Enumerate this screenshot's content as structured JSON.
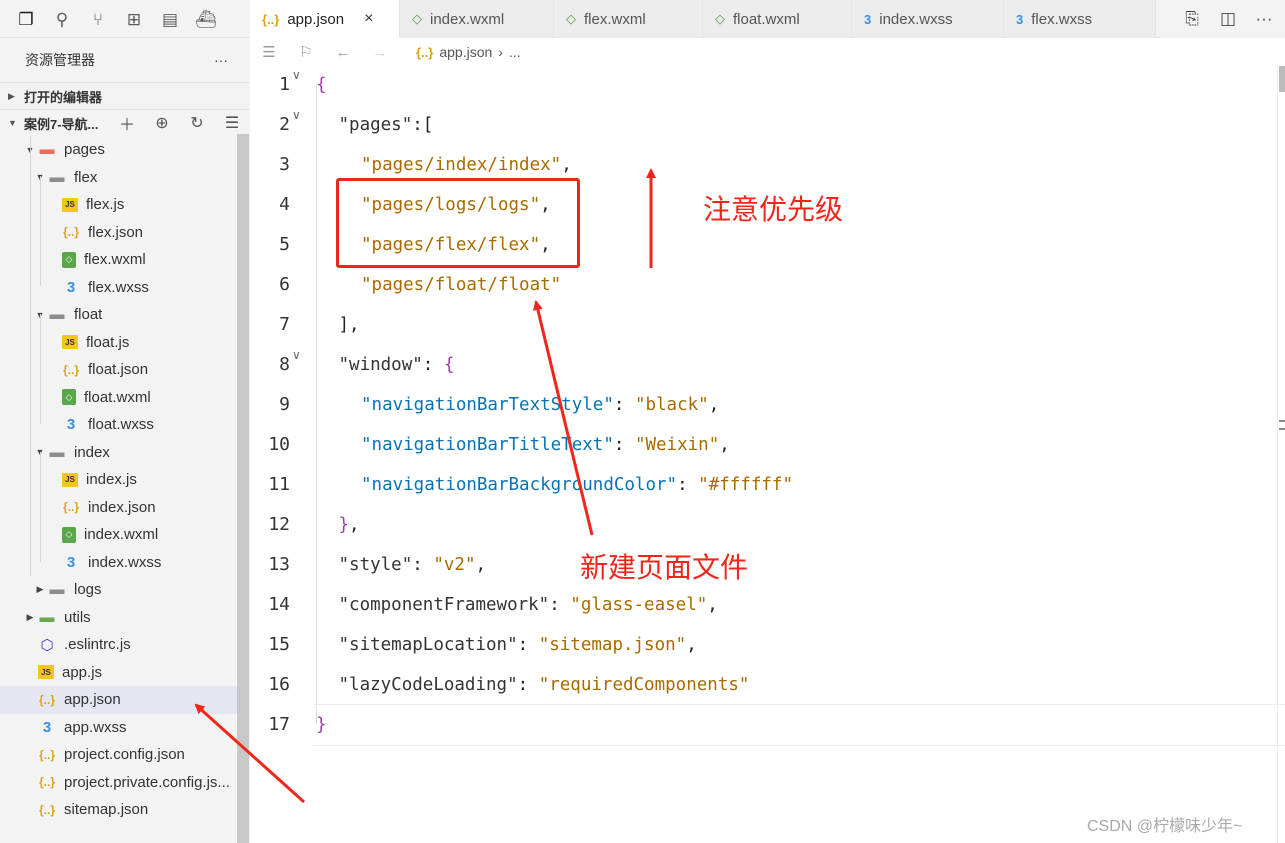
{
  "activity_icons": [
    "files-icon",
    "search-icon",
    "source-control-icon",
    "extensions-icon",
    "window-icon",
    "docker-icon"
  ],
  "tabs": [
    {
      "label": "app.json",
      "icon": "{..}",
      "kind": "json",
      "active": true,
      "close": "×"
    },
    {
      "label": "index.wxml",
      "icon": "◇",
      "kind": "wxml"
    },
    {
      "label": "flex.wxml",
      "icon": "◇",
      "kind": "wxml"
    },
    {
      "label": "float.wxml",
      "icon": "◇",
      "kind": "wxml"
    },
    {
      "label": "index.wxss",
      "icon": "3",
      "kind": "wxss"
    },
    {
      "label": "flex.wxss",
      "icon": "3",
      "kind": "wxss"
    }
  ],
  "sidebar": {
    "title": "资源管理器",
    "more": "···",
    "open_editors": "打开的编辑器",
    "project": "案例7-导航...",
    "tree": [
      {
        "label": "pages",
        "depth": 1,
        "type": "pages-folder",
        "twisty": "▼"
      },
      {
        "label": "flex",
        "depth": 2,
        "type": "folder",
        "twisty": "▼"
      },
      {
        "label": "flex.js",
        "depth": 3,
        "type": "js"
      },
      {
        "label": "flex.json",
        "depth": 3,
        "type": "json"
      },
      {
        "label": "flex.wxml",
        "depth": 3,
        "type": "wxml"
      },
      {
        "label": "flex.wxss",
        "depth": 3,
        "type": "wxss"
      },
      {
        "label": "float",
        "depth": 2,
        "type": "folder",
        "twisty": "▼"
      },
      {
        "label": "float.js",
        "depth": 3,
        "type": "js"
      },
      {
        "label": "float.json",
        "depth": 3,
        "type": "json"
      },
      {
        "label": "float.wxml",
        "depth": 3,
        "type": "wxml"
      },
      {
        "label": "float.wxss",
        "depth": 3,
        "type": "wxss"
      },
      {
        "label": "index",
        "depth": 2,
        "type": "folder",
        "twisty": "▼"
      },
      {
        "label": "index.js",
        "depth": 3,
        "type": "js"
      },
      {
        "label": "index.json",
        "depth": 3,
        "type": "json"
      },
      {
        "label": "index.wxml",
        "depth": 3,
        "type": "wxml"
      },
      {
        "label": "index.wxss",
        "depth": 3,
        "type": "wxss"
      },
      {
        "label": "logs",
        "depth": 2,
        "type": "folder",
        "twisty": "▶"
      },
      {
        "label": "utils",
        "depth": 1,
        "type": "folder-green",
        "twisty": "▶"
      },
      {
        "label": ".eslintrc.js",
        "depth": 1,
        "type": "eslint"
      },
      {
        "label": "app.js",
        "depth": 1,
        "type": "js"
      },
      {
        "label": "app.json",
        "depth": 1,
        "type": "json",
        "selected": true
      },
      {
        "label": "app.wxss",
        "depth": 1,
        "type": "wxss"
      },
      {
        "label": "project.config.json",
        "depth": 1,
        "type": "json"
      },
      {
        "label": "project.private.config.js...",
        "depth": 1,
        "type": "json"
      },
      {
        "label": "sitemap.json",
        "depth": 1,
        "type": "json"
      }
    ]
  },
  "breadcrumb": {
    "icon": "{..}",
    "file": "app.json",
    "sep": "›",
    "rest": "..."
  },
  "editor": {
    "lines": [
      {
        "n": "1",
        "tokens": [
          [
            "br",
            "{"
          ]
        ],
        "indent": 0,
        "fold": "∨"
      },
      {
        "n": "2",
        "tokens": [
          [
            "k",
            "\"pages\""
          ],
          [
            "p",
            ":["
          ]
        ],
        "indent": 1,
        "fold": "∨"
      },
      {
        "n": "3",
        "tokens": [
          [
            "s",
            "\"pages/index/index\""
          ],
          [
            "p",
            ","
          ]
        ],
        "indent": 2
      },
      {
        "n": "4",
        "tokens": [
          [
            "s",
            "\"pages/logs/logs\""
          ],
          [
            "p",
            ","
          ]
        ],
        "indent": 2
      },
      {
        "n": "5",
        "tokens": [
          [
            "s",
            "\"pages/flex/flex\""
          ],
          [
            "p",
            ","
          ]
        ],
        "indent": 2
      },
      {
        "n": "6",
        "tokens": [
          [
            "s",
            "\"pages/float/float\""
          ]
        ],
        "indent": 2
      },
      {
        "n": "7",
        "tokens": [
          [
            "p",
            "],"
          ]
        ],
        "indent": 1
      },
      {
        "n": "8",
        "tokens": [
          [
            "k",
            "\"window\""
          ],
          [
            "p",
            ": "
          ],
          [
            "br",
            "{"
          ]
        ],
        "indent": 1,
        "fold": "∨"
      },
      {
        "n": "9",
        "tokens": [
          [
            "kb",
            "\"navigationBarTextStyle\""
          ],
          [
            "p",
            ": "
          ],
          [
            "s",
            "\"black\""
          ],
          [
            "p",
            ","
          ]
        ],
        "indent": 2
      },
      {
        "n": "10",
        "tokens": [
          [
            "kb",
            "\"navigationBarTitleText\""
          ],
          [
            "p",
            ": "
          ],
          [
            "s",
            "\"Weixin\""
          ],
          [
            "p",
            ","
          ]
        ],
        "indent": 2
      },
      {
        "n": "11",
        "tokens": [
          [
            "kb",
            "\"navigationBarBackgroundColor\""
          ],
          [
            "p",
            ": "
          ],
          [
            "s",
            "\"#ffffff\""
          ]
        ],
        "indent": 2
      },
      {
        "n": "12",
        "tokens": [
          [
            "br",
            "}"
          ],
          [
            "p",
            ","
          ]
        ],
        "indent": 1
      },
      {
        "n": "13",
        "tokens": [
          [
            "k",
            "\"style\""
          ],
          [
            "p",
            ": "
          ],
          [
            "s",
            "\"v2\""
          ],
          [
            "p",
            ","
          ]
        ],
        "indent": 1
      },
      {
        "n": "14",
        "tokens": [
          [
            "k",
            "\"componentFramework\""
          ],
          [
            "p",
            ": "
          ],
          [
            "s",
            "\"glass-easel\""
          ],
          [
            "p",
            ","
          ]
        ],
        "indent": 1
      },
      {
        "n": "15",
        "tokens": [
          [
            "k",
            "\"sitemapLocation\""
          ],
          [
            "p",
            ": "
          ],
          [
            "s",
            "\"sitemap.json\""
          ],
          [
            "p",
            ","
          ]
        ],
        "indent": 1
      },
      {
        "n": "16",
        "tokens": [
          [
            "k",
            "\"lazyCodeLoading\""
          ],
          [
            "p",
            ": "
          ],
          [
            "s",
            "\"requiredComponents\""
          ]
        ],
        "indent": 1
      },
      {
        "n": "17",
        "tokens": [
          [
            "br",
            "}"
          ]
        ],
        "indent": 0
      }
    ]
  },
  "annotations": {
    "priority_note": "注意优先级",
    "new_file_note": "新建页面文件",
    "color": "#f0261a"
  },
  "watermark": "CSDN @柠檬味少年~"
}
